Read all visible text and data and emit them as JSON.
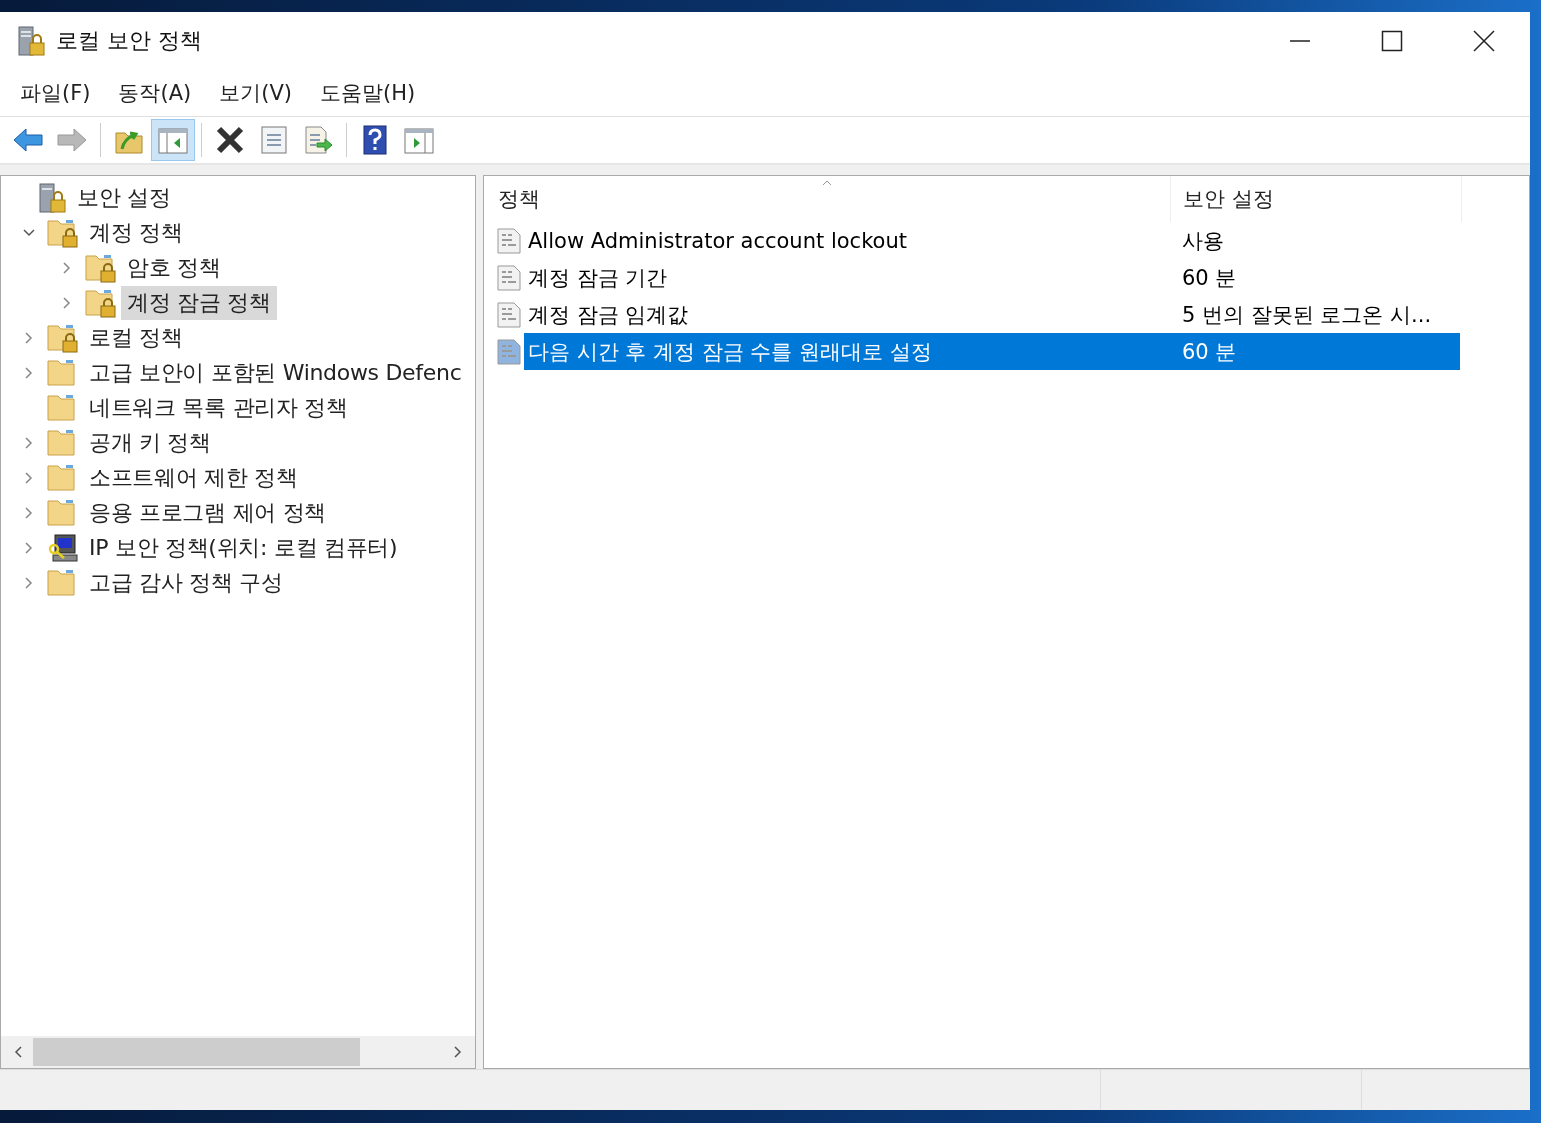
{
  "window": {
    "title": "로컬 보안 정책"
  },
  "menu": [
    "파일(F)",
    "동작(A)",
    "보기(V)",
    "도움말(H)"
  ],
  "toolbar": [
    {
      "kind": "back",
      "disabled": false,
      "pressed": false
    },
    {
      "kind": "forward",
      "disabled": true,
      "pressed": false
    },
    {
      "kind": "separator"
    },
    {
      "kind": "up",
      "disabled": false,
      "pressed": false
    },
    {
      "kind": "tree",
      "disabled": false,
      "pressed": true
    },
    {
      "kind": "separator"
    },
    {
      "kind": "delete",
      "disabled": false,
      "pressed": false
    },
    {
      "kind": "properties",
      "disabled": false,
      "pressed": false
    },
    {
      "kind": "export",
      "disabled": false,
      "pressed": false
    },
    {
      "kind": "separator"
    },
    {
      "kind": "help",
      "disabled": false,
      "pressed": false
    },
    {
      "kind": "action-pane",
      "disabled": false,
      "pressed": false
    }
  ],
  "tree": [
    {
      "label": "보안 설정",
      "kind": "server",
      "selected": false,
      "children": [
        {
          "label": "계정 정책",
          "kind": "locked-folder",
          "expanded": true,
          "selected": false,
          "children": [
            {
              "label": "암호 정책",
              "kind": "locked-folder",
              "expanded": false,
              "selected": false
            },
            {
              "label": "계정 잠금 정책",
              "kind": "locked-folder",
              "expanded": false,
              "selected": true
            }
          ]
        },
        {
          "label": "로컬 정책",
          "kind": "locked-folder",
          "expanded": false,
          "selected": false
        },
        {
          "label": "고급 보안이 포함된 Windows Defenc",
          "kind": "folder",
          "expanded": false,
          "selected": false
        },
        {
          "label": "네트워크 목록 관리자 정책",
          "kind": "folder",
          "selected": false
        },
        {
          "label": "공개 키 정책",
          "kind": "folder",
          "expanded": false,
          "selected": false
        },
        {
          "label": "소프트웨어 제한 정책",
          "kind": "folder",
          "expanded": false,
          "selected": false
        },
        {
          "label": "응용 프로그램 제어 정책",
          "kind": "folder",
          "expanded": false,
          "selected": false
        },
        {
          "label": "IP 보안 정책(위치: 로컬 컴퓨터)",
          "kind": "ip-security",
          "expanded": false,
          "selected": false
        },
        {
          "label": "고급 감사 정책 구성",
          "kind": "folder",
          "expanded": false,
          "selected": false
        }
      ]
    }
  ],
  "table": {
    "columns": [
      "정책",
      "보안 설정"
    ],
    "rows": [
      {
        "policy": "Allow Administrator account lockout",
        "setting": "사용",
        "selected": false
      },
      {
        "policy": "계정 잠금 기간",
        "setting": "60 분",
        "selected": false
      },
      {
        "policy": "계정 잠금 임계값",
        "setting": "5 번의 잘못된 로그온 시...",
        "selected": false
      },
      {
        "policy": "다음 시간 후 계정 잠금 수를 원래대로 설정",
        "setting": "60 분",
        "selected": true
      }
    ]
  }
}
